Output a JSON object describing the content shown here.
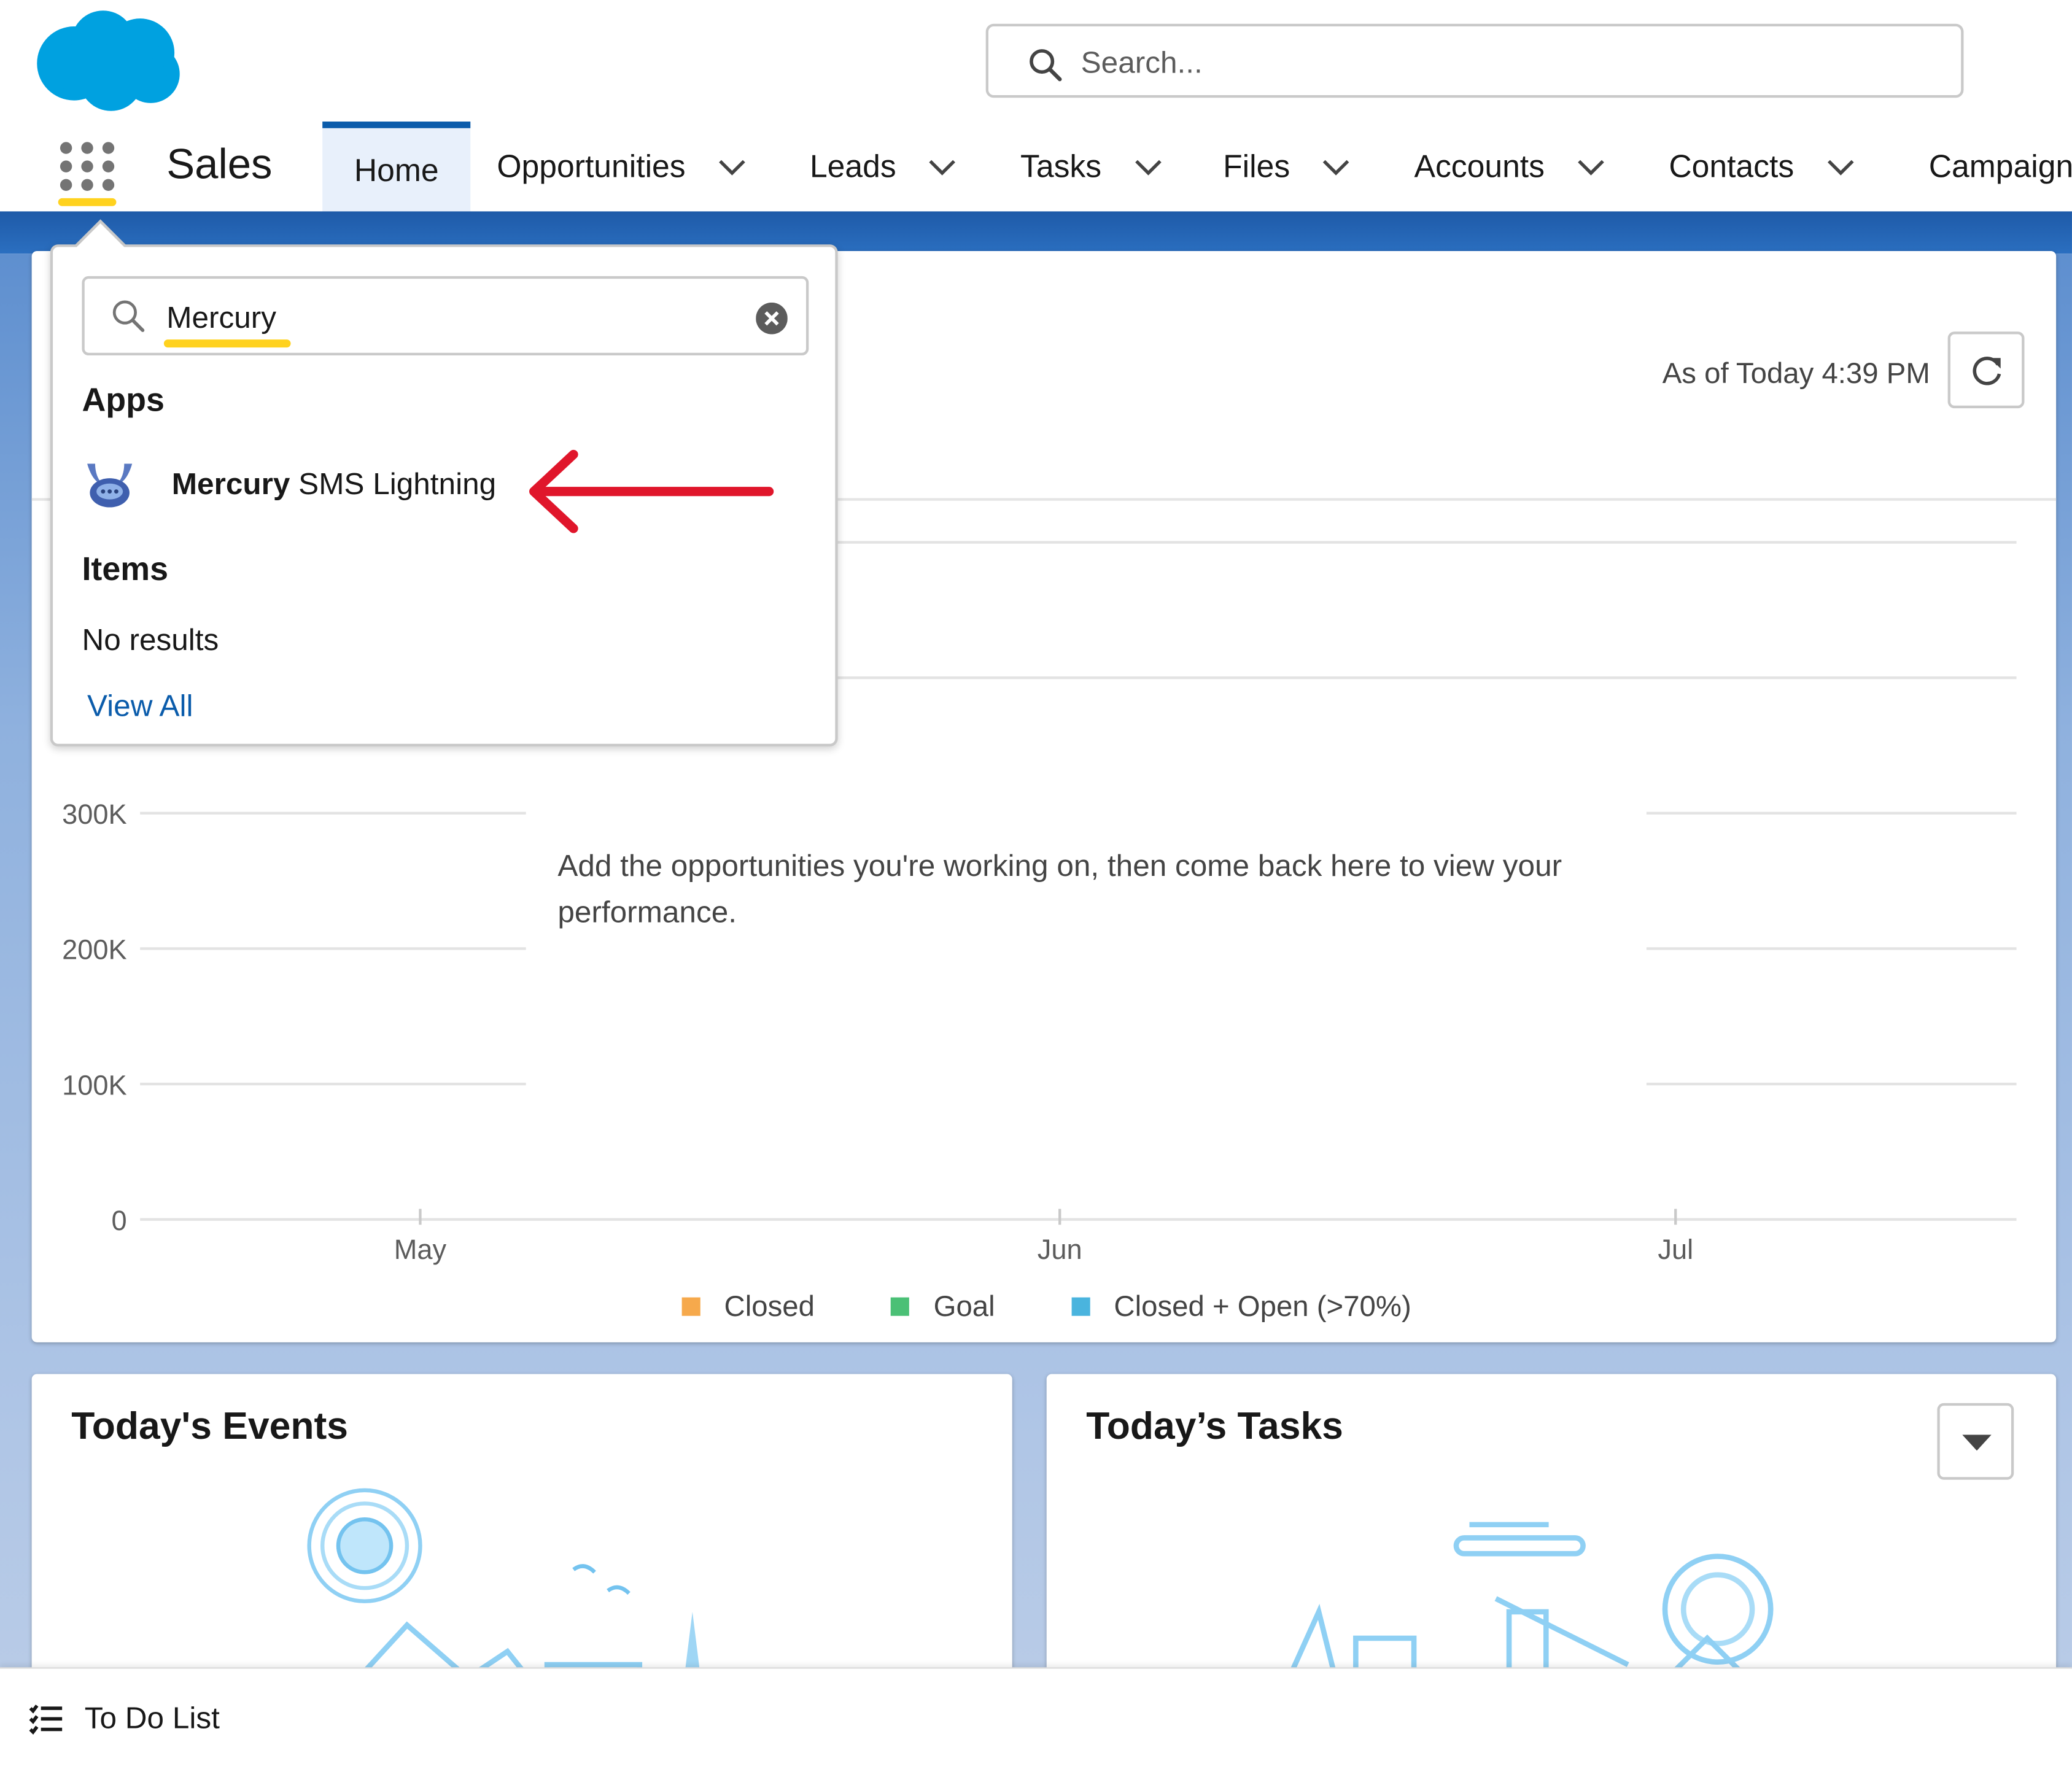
{
  "header": {
    "search_placeholder": "Search...",
    "app_name": "Sales",
    "nav": [
      {
        "label": "Home",
        "active": true,
        "dropdown": false
      },
      {
        "label": "Opportunities",
        "dropdown": true
      },
      {
        "label": "Leads",
        "dropdown": true
      },
      {
        "label": "Tasks",
        "dropdown": true
      },
      {
        "label": "Files",
        "dropdown": true
      },
      {
        "label": "Accounts",
        "dropdown": true
      },
      {
        "label": "Contacts",
        "dropdown": true
      },
      {
        "label": "Campaigns",
        "dropdown": false
      }
    ]
  },
  "app_launcher": {
    "search_value": "Mercury",
    "apps_heading": "Apps",
    "app_result": {
      "bold": "Mercury",
      "rest": " SMS Lightning"
    },
    "items_heading": "Items",
    "no_results": "No results",
    "view_all": "View All"
  },
  "performance": {
    "as_of": "As of Today 4:39 PM",
    "empty_message": "Add the opportunities you're working on, then come back here to view your performance."
  },
  "chart_data": {
    "type": "line",
    "y_ticks": [
      "0",
      "100K",
      "200K",
      "300K"
    ],
    "ylim": [
      0,
      800000
    ],
    "x_ticks": [
      "May",
      "Jun",
      "Jul"
    ],
    "legend": [
      {
        "name": "Closed",
        "color": "#f6a94c"
      },
      {
        "name": "Goal",
        "color": "#4bc076"
      },
      {
        "name": "Closed + Open (>70%)",
        "color": "#4ab4de"
      }
    ],
    "series": [],
    "grid": true
  },
  "events": {
    "title": "Today's Events"
  },
  "tasks": {
    "title": "Today’s Tasks"
  },
  "utility": {
    "todo_label": "To Do List"
  },
  "colors": {
    "brand_blue": "#0b5cab",
    "salesforce_cloud": "#00a1e0",
    "highlight_yellow": "#ffd21f",
    "annotation_red": "#e0162b"
  }
}
